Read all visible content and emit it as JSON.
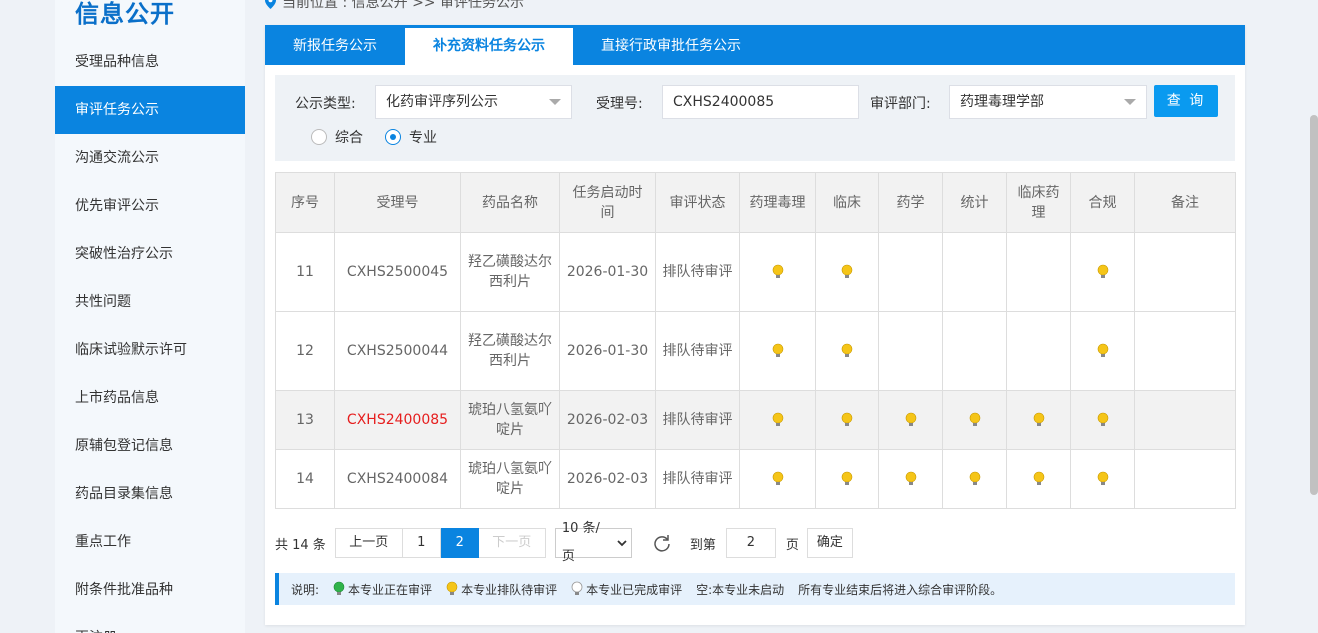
{
  "sidebar": {
    "title": "信息公开",
    "items": [
      {
        "label": "受理品种信息"
      },
      {
        "label": "审评任务公示"
      },
      {
        "label": "沟通交流公示"
      },
      {
        "label": "优先审评公示"
      },
      {
        "label": "突破性治疗公示"
      },
      {
        "label": "共性问题"
      },
      {
        "label": "临床试验默示许可"
      },
      {
        "label": "上市药品信息"
      },
      {
        "label": "原辅包登记信息"
      },
      {
        "label": "药品目录集信息"
      },
      {
        "label": "重点工作"
      },
      {
        "label": "附条件批准品种"
      },
      {
        "label": "再注册"
      }
    ],
    "active_index": 1
  },
  "breadcrumb": "当前位置 : 信息公开 >> 审评任务公示",
  "tabs": [
    {
      "label": "新报任务公示"
    },
    {
      "label": "补充资料任务公示"
    },
    {
      "label": "直接行政审批任务公示"
    }
  ],
  "active_tab": 1,
  "filter": {
    "type_label": "公示类型:",
    "type_value": "化药审评序列公示",
    "accept_label": "受理号:",
    "accept_value": "CXHS2400085",
    "dept_label": "审评部门:",
    "dept_value": "药理毒理学部",
    "query_button": "查 询",
    "radio_comprehensive": "综合",
    "radio_specialty": "专业",
    "selected_radio": "专业"
  },
  "table": {
    "headers": [
      "序号",
      "受理号",
      "药品名称",
      "任务启动时间",
      "审评状态",
      "药理毒理",
      "临床",
      "药学",
      "统计",
      "临床药理",
      "合规",
      "备注"
    ],
    "rows": [
      {
        "no": "11",
        "accept": "CXHS2500045",
        "name": "羟乙磺酸达尔西利片",
        "start": "2026-01-30",
        "status": "排队待审评",
        "bulbs": [
          true,
          true,
          false,
          false,
          false,
          true
        ],
        "note": ""
      },
      {
        "no": "12",
        "accept": "CXHS2500044",
        "name": "羟乙磺酸达尔西利片",
        "start": "2026-01-30",
        "status": "排队待审评",
        "bulbs": [
          true,
          true,
          false,
          false,
          false,
          true
        ],
        "note": ""
      },
      {
        "no": "13",
        "accept": "CXHS2400085",
        "name": "琥珀八氢氨吖啶片",
        "start": "2026-02-03",
        "status": "排队待审评",
        "bulbs": [
          true,
          true,
          true,
          true,
          true,
          true
        ],
        "note": ""
      },
      {
        "no": "14",
        "accept": "CXHS2400084",
        "name": "琥珀八氢氨吖啶片",
        "start": "2026-02-03",
        "status": "排队待审评",
        "bulbs": [
          true,
          true,
          true,
          true,
          true,
          true
        ],
        "note": ""
      }
    ],
    "highlight_row": 2,
    "bulb_color": "#f5c518"
  },
  "pager": {
    "total": "共 14 条",
    "prev": "上一页",
    "page1": "1",
    "page2": "2",
    "next": "下一页",
    "page_size": "10 条/页",
    "goto_prefix": "到第",
    "goto_value": "2",
    "goto_suffix": "页",
    "confirm": "确定"
  },
  "legend": {
    "prefix": "说明:",
    "green": "本专业正在审评",
    "yellow": "本专业排队待审评",
    "gray": "本专业已完成审评",
    "empty": "空:本专业未启动",
    "note": "所有专业结束后将进入综合审评阶段。"
  },
  "colors": {
    "accent": "#0a84e0",
    "highlight_text": "#e61e1e",
    "green_bulb": "#2fb34a",
    "yellow_bulb": "#f5c518",
    "gray_bulb": "#d8d8d8"
  }
}
